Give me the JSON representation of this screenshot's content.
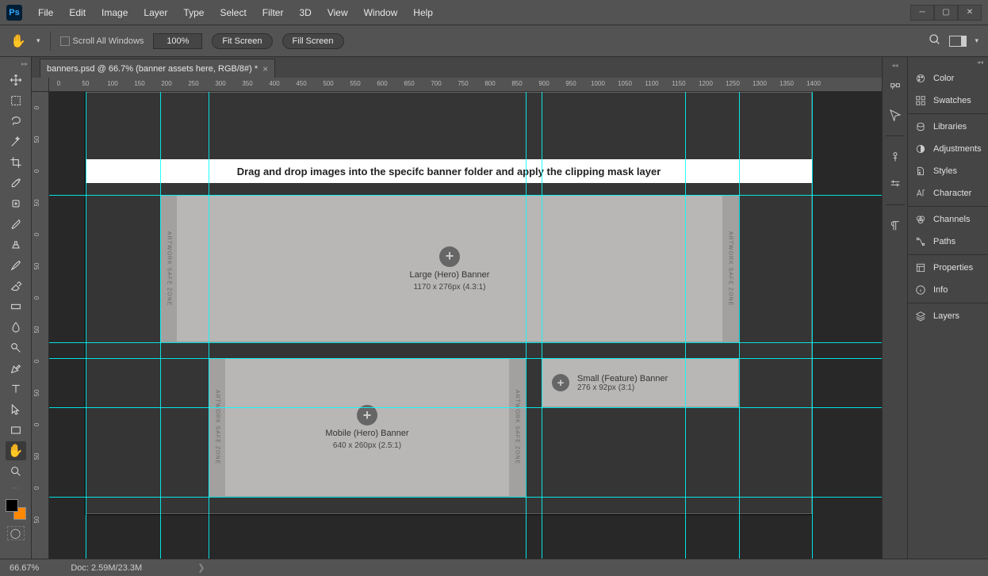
{
  "app": {
    "logo": "Ps"
  },
  "menu": [
    "File",
    "Edit",
    "Image",
    "Layer",
    "Type",
    "Select",
    "Filter",
    "3D",
    "View",
    "Window",
    "Help"
  ],
  "options": {
    "scroll_all": "Scroll All Windows",
    "zoom": "100%",
    "fit": "Fit Screen",
    "fill": "Fill Screen"
  },
  "tab": {
    "title": "banners.psd @ 66.7% (banner assets here, RGB/8#) *"
  },
  "ruler_h": [
    "0",
    "50",
    "100",
    "150",
    "200",
    "250",
    "300",
    "350",
    "400",
    "450",
    "500",
    "550",
    "600",
    "650",
    "700",
    "750",
    "800",
    "850",
    "900",
    "950",
    "1000",
    "1050",
    "1100",
    "1150",
    "1200",
    "1250",
    "1300",
    "1350",
    "1400"
  ],
  "ruler_v": [
    "0",
    "50",
    "0",
    "50",
    "0",
    "50",
    "0",
    "50",
    "0",
    "50",
    "0",
    "50",
    "0",
    "50"
  ],
  "canvas": {
    "instruction": "Drag and drop images into the specifc banner folder and apply the clipping mask layer",
    "safezone": "ARTWORK SAFE ZONE",
    "slots": {
      "large": {
        "title": "Large (Hero) Banner",
        "dims": "1170 x 276px (4.3:1)"
      },
      "mobile": {
        "title": "Mobile (Hero) Banner",
        "dims": "640 x 260px (2.5:1)"
      },
      "small": {
        "title": "Small (Feature) Banner",
        "dims": "276 x 92px (3:1)"
      }
    }
  },
  "panels": [
    "Color",
    "Swatches",
    "Libraries",
    "Adjustments",
    "Styles",
    "Character",
    "Channels",
    "Paths",
    "Properties",
    "Info",
    "Layers"
  ],
  "status": {
    "zoom": "66.67%",
    "doc": "Doc: 2.59M/23.3M"
  }
}
